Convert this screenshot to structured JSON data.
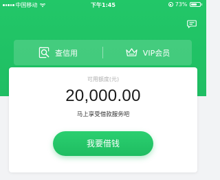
{
  "status_bar": {
    "carrier": "中国移动",
    "time": "下午1:45",
    "battery_percent": "73%",
    "battery_level": 0.73
  },
  "header": {
    "message_icon": "message-icon"
  },
  "features": [
    {
      "label": "查信用",
      "icon": "credit-search-icon"
    },
    {
      "label": "VIP会员",
      "icon": "vip-crown-icon"
    }
  ],
  "loan_card": {
    "credit_label": "可用额度(元)",
    "credit_amount": "20,000.00",
    "slogan": "马上享受借款服务吧",
    "borrow_button": "我要借钱"
  },
  "colors": {
    "brand_green": "#1fbe63",
    "text_dark": "#1a1a1a",
    "text_muted": "#b0b0b0"
  }
}
